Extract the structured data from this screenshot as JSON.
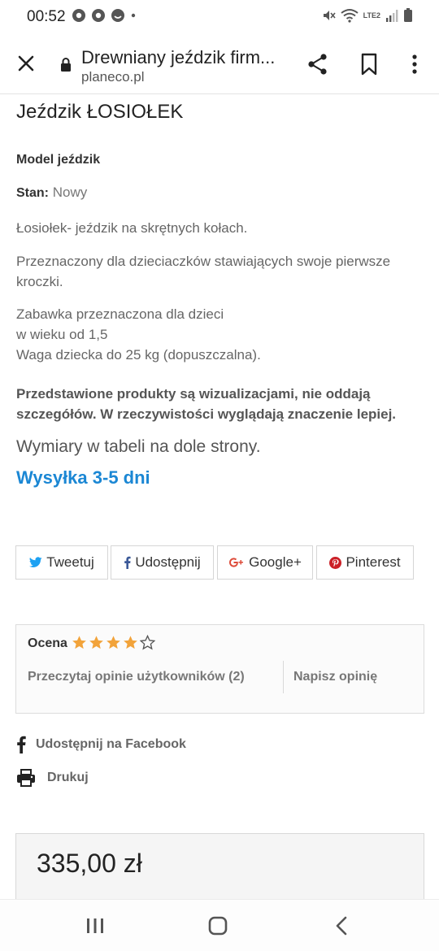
{
  "status_bar": {
    "time": "00:52",
    "network_label": "LTE2"
  },
  "browser": {
    "page_title": "Drewniany jeździk firm...",
    "domain": "planeco.pl"
  },
  "product": {
    "title": "Jeździk ŁOSIOŁEK",
    "model": "Model jeździk",
    "stan_label": "Stan:",
    "stan_value": "Nowy",
    "desc_1": "Łosiołek- jeździk na skrętnych kołach.",
    "desc_2": "Przeznaczony dla dzieciaczków stawiających swoje pierwsze kroczki.",
    "desc_3_line1": "Zabawka przeznaczona dla dzieci",
    "desc_3_line2": "w wieku od 1,5",
    "desc_3_line3": "Waga dziecka do 25 kg (dopuszczalna).",
    "note": "Przedstawione produkty są wizualizacjami, nie oddają szczegółów. W rzeczywistości wyglądają znaczenie lepiej.",
    "dimensions": "Wymiary w tabeli na dole strony.",
    "shipping": "Wysyłka 3-5 dni",
    "price": "335,00 zł"
  },
  "social": {
    "tweet": "Tweetuj",
    "facebook": "Udostępnij",
    "google": "Google+",
    "pinterest": "Pinterest"
  },
  "rating": {
    "label": "Ocena",
    "stars_filled": 4,
    "stars_total": 5,
    "read_reviews": "Przeczytaj opinie użytkowników (2)",
    "write_review": "Napisz opinię"
  },
  "actions": {
    "fb_share": "Udostępnij na Facebook",
    "print": "Drukuj"
  },
  "colors": {
    "accent_blue": "#1b87d4",
    "star": "#f2a33a"
  }
}
